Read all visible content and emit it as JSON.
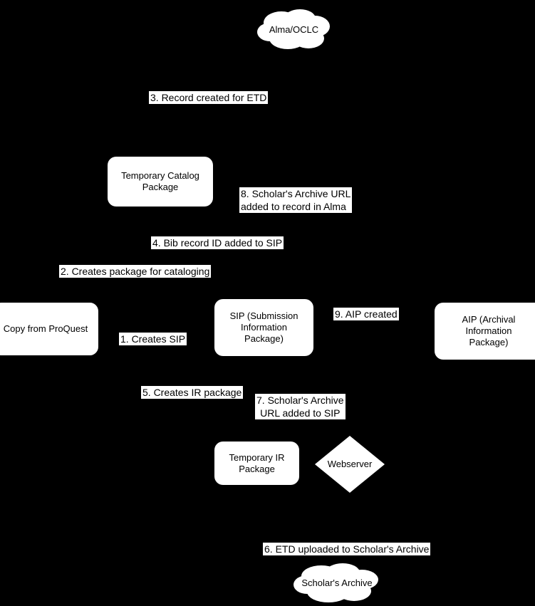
{
  "diagram": {
    "title": "ETD ingest workflow",
    "background_color": "#000000",
    "node_fill_color": "#ffffff",
    "node_text_color": "#000000",
    "nodes": [
      {
        "id": "alma_oclc",
        "label": "Alma/OCLC",
        "shape": "cloud"
      },
      {
        "id": "temp_catalog",
        "label": "Temporary Catalog\nPackage",
        "shape": "rounded-rect"
      },
      {
        "id": "proquest",
        "label": "Copy from ProQuest",
        "shape": "rounded-rect"
      },
      {
        "id": "sip",
        "label": "SIP (Submission\nInformation Package)",
        "shape": "rounded-rect"
      },
      {
        "id": "aip",
        "label": "AIP (Archival Information\nPackage)",
        "shape": "rounded-rect"
      },
      {
        "id": "temp_ir",
        "label": "Temporary IR\nPackage",
        "shape": "rounded-rect"
      },
      {
        "id": "webserver",
        "label": "Webserver",
        "shape": "diamond"
      },
      {
        "id": "scholars_archive",
        "label": "Scholar's Archive",
        "shape": "cloud"
      }
    ],
    "edge_labels": [
      {
        "id": "step1",
        "text": "1. Creates SIP"
      },
      {
        "id": "step2",
        "text": "2. Creates package for cataloging"
      },
      {
        "id": "step3",
        "text": "3. Record created for ETD"
      },
      {
        "id": "step4",
        "text": "4. Bib record ID added to SIP"
      },
      {
        "id": "step5",
        "text": "5. Creates IR package"
      },
      {
        "id": "step6",
        "text": "6. ETD uploaded to Scholar's Archive"
      },
      {
        "id": "step7",
        "text": "7. Scholar's Archive\nURL added to SIP"
      },
      {
        "id": "step8",
        "text": "8. Scholar's Archive URL\nadded to record in Alma"
      },
      {
        "id": "step9",
        "text": "9. AIP created"
      }
    ]
  }
}
